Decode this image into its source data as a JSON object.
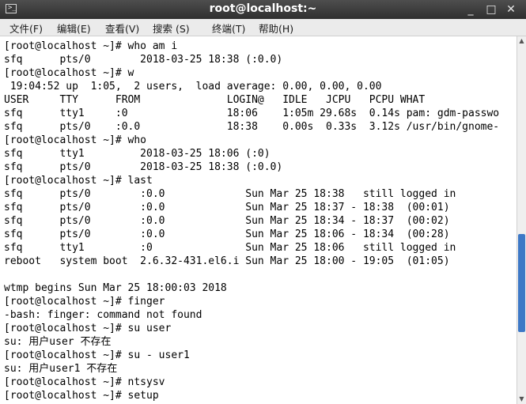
{
  "window": {
    "title": "root@localhost:~",
    "icon": "terminal-icon",
    "controls": {
      "minimize": "_",
      "maximize": "□",
      "close": "✕"
    }
  },
  "menu": [
    {
      "label": "文件(F)"
    },
    {
      "label": "编辑(E)"
    },
    {
      "label": "查看(V)"
    },
    {
      "label": "搜索 (S)"
    },
    {
      "label": "终端(T)"
    },
    {
      "label": "帮助(H)"
    }
  ],
  "terminal": {
    "lines": [
      "[root@localhost ~]# who am i",
      "sfq      pts/0        2018-03-25 18:38 (:0.0)",
      "[root@localhost ~]# w",
      " 19:04:52 up  1:05,  2 users,  load average: 0.00, 0.00, 0.00",
      "USER     TTY      FROM              LOGIN@   IDLE   JCPU   PCPU WHAT",
      "sfq      tty1     :0                18:06    1:05m 29.68s  0.14s pam: gdm-passwo",
      "sfq      pts/0    :0.0              18:38    0.00s  0.33s  3.12s /usr/bin/gnome-",
      "[root@localhost ~]# who",
      "sfq      tty1         2018-03-25 18:06 (:0)",
      "sfq      pts/0        2018-03-25 18:38 (:0.0)",
      "[root@localhost ~]# last",
      "sfq      pts/0        :0.0             Sun Mar 25 18:38   still logged in",
      "sfq      pts/0        :0.0             Sun Mar 25 18:37 - 18:38  (00:01)",
      "sfq      pts/0        :0.0             Sun Mar 25 18:34 - 18:37  (00:02)",
      "sfq      pts/0        :0.0             Sun Mar 25 18:06 - 18:34  (00:28)",
      "sfq      tty1         :0               Sun Mar 25 18:06   still logged in",
      "reboot   system boot  2.6.32-431.el6.i Sun Mar 25 18:00 - 19:05  (01:05)",
      "",
      "wtmp begins Sun Mar 25 18:00:03 2018",
      "[root@localhost ~]# finger",
      "-bash: finger: command not found",
      "[root@localhost ~]# su user",
      "su: 用户user 不存在",
      "[root@localhost ~]# su - user1",
      "su: 用户user1 不存在",
      "[root@localhost ~]# ntsysv",
      "[root@localhost ~]# setup"
    ]
  },
  "scrollbar": {
    "position": 0.75
  }
}
